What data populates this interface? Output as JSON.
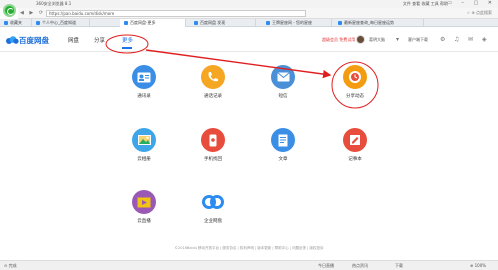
{
  "browser": {
    "window_title": "360安全浏览器 8.1",
    "menu": "文件  查看  收藏  工具  帮助",
    "window_controls": "▭ – ▢ ✕",
    "nav_buttons": "◀ ▶ ⟳ ⌂",
    "url": "https://pan.baidu.com/disk/more",
    "addr_right": "☆ ⊕ 点此搜索",
    "tabs": [
      {
        "label": "收藏夹",
        "active": false
      },
      {
        "label": "个人中心_百度知道",
        "active": false
      },
      {
        "label": "百度网盘-更多",
        "active": true
      },
      {
        "label": "百度网盘 发现",
        "active": false
      },
      {
        "label": "王牌星座网 - 您的星座",
        "active": false
      },
      {
        "label": "最新星座查询_每日星座运势",
        "active": false
      }
    ]
  },
  "app": {
    "name": "百度网盘",
    "nav": [
      {
        "label": "网盘",
        "active": false
      },
      {
        "label": "分享",
        "active": false
      },
      {
        "label": "更多",
        "active": true
      }
    ],
    "header_right": {
      "vip_text": "超级会员 免费试用",
      "username": "葛明大脑",
      "client_download": "客户端下载"
    }
  },
  "tiles": [
    {
      "label": "通讯录",
      "icon": "contacts-icon"
    },
    {
      "label": "通话记录",
      "icon": "phone-icon"
    },
    {
      "label": "短信",
      "icon": "message-icon"
    },
    {
      "label": "分享动态",
      "icon": "share-dynamic-icon"
    },
    {
      "label": "云相册",
      "icon": "photo-icon"
    },
    {
      "label": "手机找回",
      "icon": "phone-find-icon"
    },
    {
      "label": "文章",
      "icon": "article-icon"
    },
    {
      "label": "记事本",
      "icon": "notebook-icon"
    },
    {
      "label": "云直播",
      "icon": "live-icon"
    },
    {
      "label": "企业网盘",
      "icon": "enterprise-icon"
    }
  ],
  "footer": {
    "text": "©2016Baidu  移动开放平台 | 服务协议 | 权利声明 | 版本更新 | 帮助中心 | 问题反馈 | 版权投诉"
  },
  "statusbar": {
    "left": "⊙ 完成",
    "items": [
      "今日直播",
      "热点资讯",
      "下载",
      "⊕ 100%"
    ]
  },
  "colors": {
    "brand_blue": "#1e6fd9",
    "annotation_red": "#e02020"
  }
}
